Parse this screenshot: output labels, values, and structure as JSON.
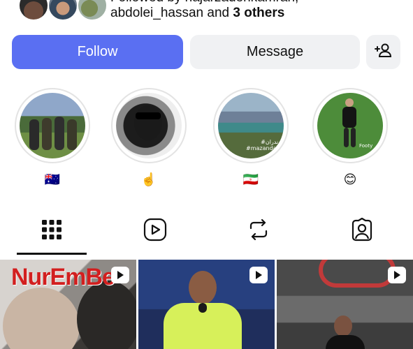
{
  "followed_by": {
    "line1": "Followed by hajarzadehkamran,",
    "user": "abdolei_hassan",
    "and_text": " and ",
    "others": "3 others"
  },
  "actions": {
    "follow_label": "Follow",
    "message_label": "Message",
    "add_user_icon": "person-plus-icon"
  },
  "highlights": [
    {
      "label": "🇦🇺"
    },
    {
      "label": "☝️"
    },
    {
      "label": "🇮🇷"
    },
    {
      "label": "😊"
    }
  ],
  "highlight_overlays": {
    "h3_text": "#مازندران\n#mazandaran",
    "h4_text": "Footy"
  },
  "tabs": [
    {
      "name": "grid",
      "icon": "grid-icon",
      "selected": true
    },
    {
      "name": "reels",
      "icon": "reels-icon",
      "selected": false
    },
    {
      "name": "reposts",
      "icon": "repost-icon",
      "selected": false
    },
    {
      "name": "tagged",
      "icon": "tagged-icon",
      "selected": false
    }
  ],
  "grid_posts": [
    {
      "overlay_text": "NurEmBe",
      "badge_icon": "reel-icon"
    },
    {
      "overlay_text": "",
      "badge_icon": "reel-icon"
    },
    {
      "overlay_text": "",
      "badge_icon": "reel-icon"
    }
  ],
  "colors": {
    "follow_button": "#5a6ff2",
    "secondary_button": "#f0f1f3",
    "text": "#0f0f0f"
  }
}
